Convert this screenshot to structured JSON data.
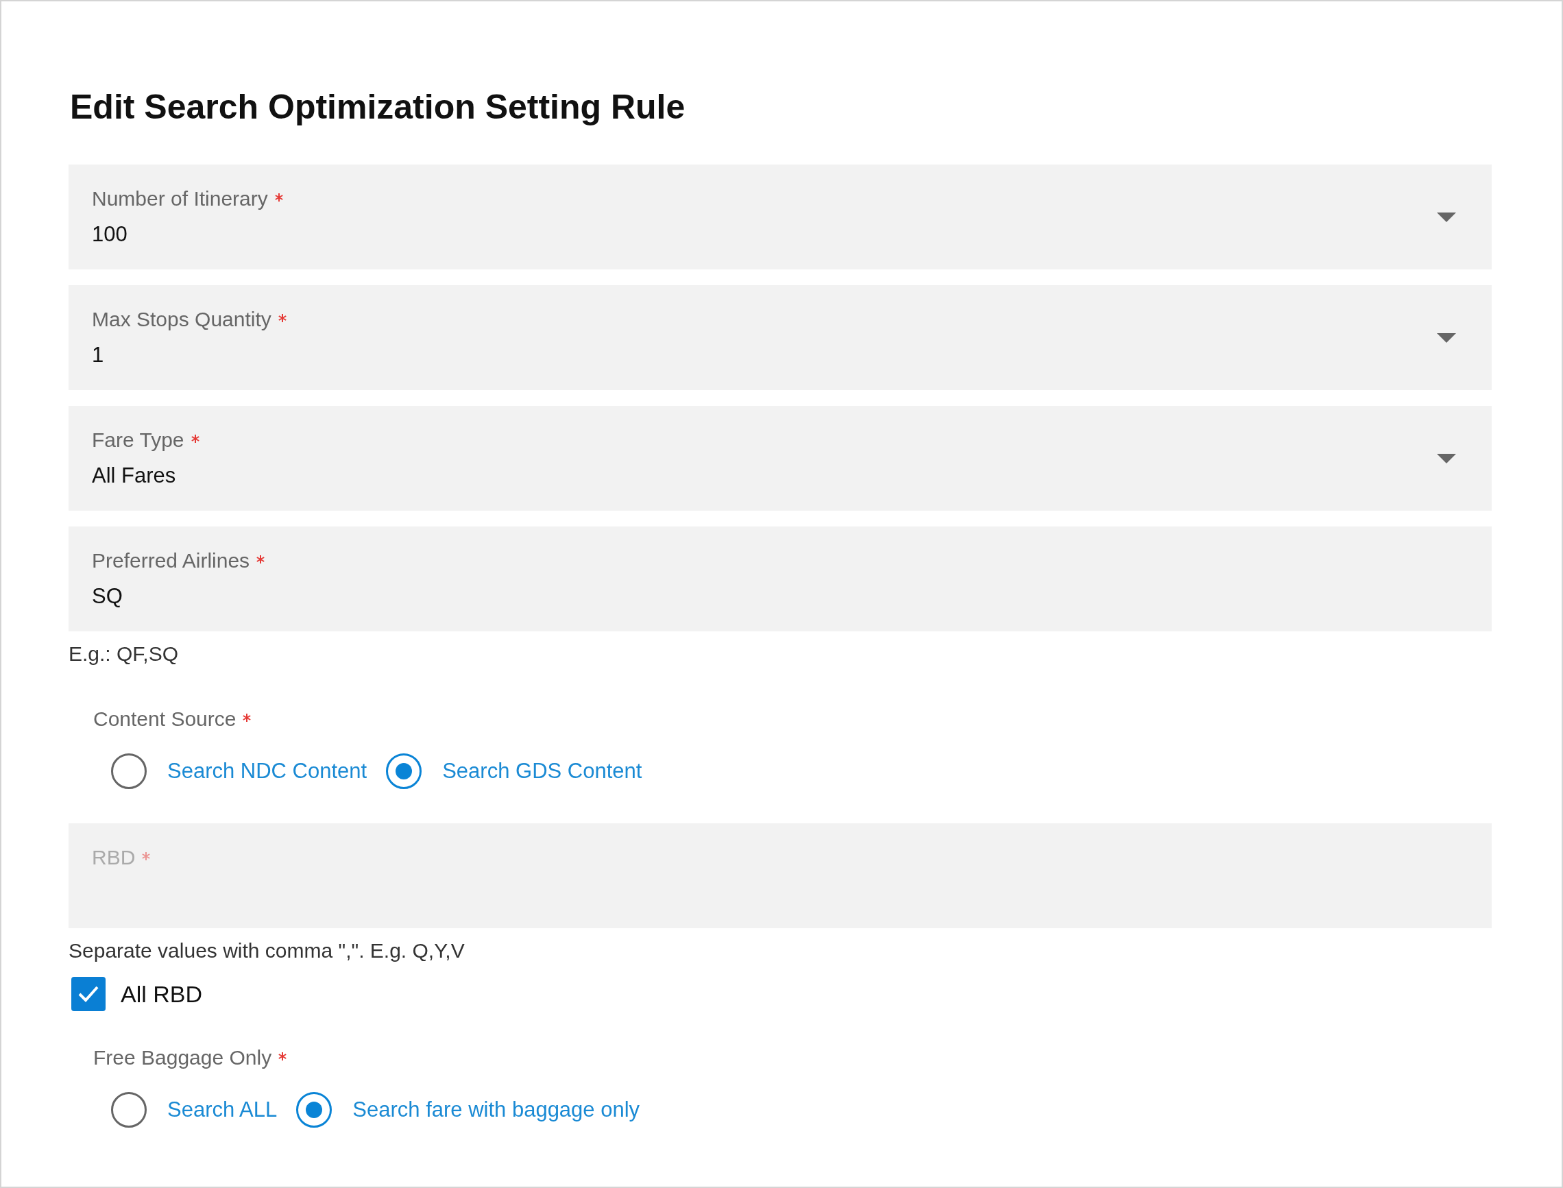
{
  "title": "Edit Search Optimization Setting Rule",
  "fields": [
    {
      "kind": "select",
      "label": "Number of Itinerary",
      "required": true,
      "value": "100"
    },
    {
      "kind": "select",
      "label": "Max Stops Quantity",
      "required": true,
      "value": "1"
    },
    {
      "kind": "select",
      "label": "Fare Type",
      "required": true,
      "value": "All Fares"
    },
    {
      "kind": "text",
      "label": "Preferred Airlines",
      "required": true,
      "disabled": false,
      "value": "SQ",
      "hint": "E.g.: QF,SQ"
    },
    {
      "kind": "radio",
      "label": "Content Source",
      "required": true,
      "options": [
        {
          "label": "Search NDC Content",
          "selected": false
        },
        {
          "label": "Search GDS Content",
          "selected": true
        }
      ]
    },
    {
      "kind": "text",
      "label": "RBD",
      "required": true,
      "disabled": true,
      "hint": "Separate values with comma \",\". E.g. Q,Y,V"
    },
    {
      "kind": "checkbox",
      "label": "All RBD",
      "checked": true
    },
    {
      "kind": "radio",
      "label": "Free Baggage Only",
      "required": true,
      "options": [
        {
          "label": "Search ALL",
          "selected": false
        },
        {
          "label": "Search fare with baggage only",
          "selected": true
        }
      ]
    }
  ]
}
